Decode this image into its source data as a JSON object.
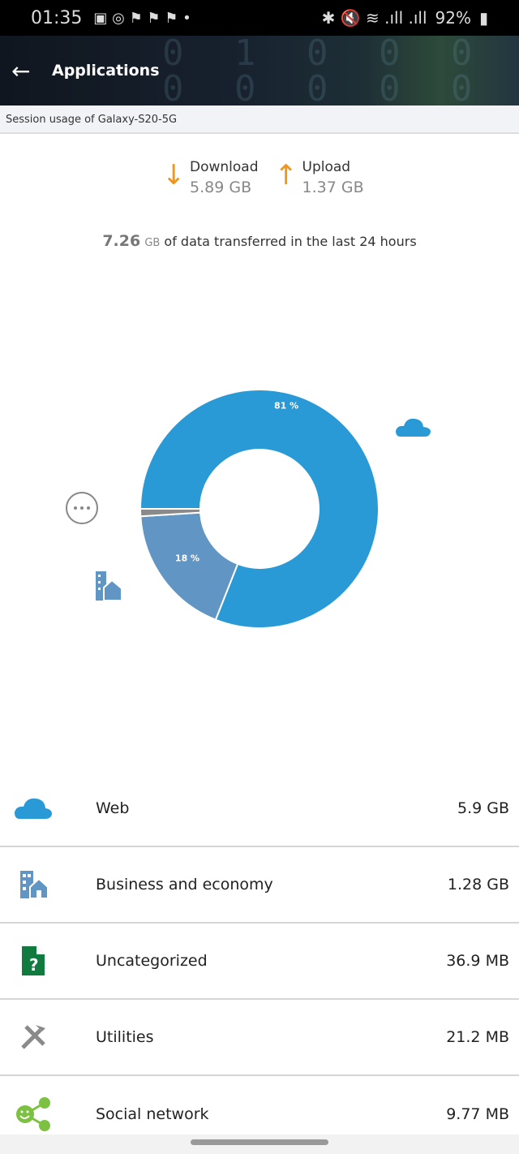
{
  "status_bar": {
    "time": "01:35",
    "battery": "92%"
  },
  "header": {
    "title": "Applications",
    "subtitle": "Session usage of Galaxy-S20-5G"
  },
  "transfer": {
    "download_label": "Download",
    "download_value": "5.89 GB",
    "upload_label": "Upload",
    "upload_value": "1.37 GB"
  },
  "summary": {
    "amount": "7.26",
    "unit": "GB",
    "text": "of data transferred in the last 24 hours"
  },
  "colors": {
    "web": "#2a9ad6",
    "business": "#6196c4",
    "other": "#8a8a8a",
    "accent": "#f0961e"
  },
  "chart_data": {
    "type": "pie",
    "donut": true,
    "start": "left",
    "direction": "clockwise",
    "categories": [
      "Web",
      "Business and economy",
      "Other"
    ],
    "values": [
      81,
      18,
      1
    ],
    "labels": [
      "81 %",
      "18 %",
      ""
    ],
    "icons": [
      "cloud-icon",
      "business-icon",
      "more-icon"
    ]
  },
  "categories": [
    {
      "name": "Web",
      "size": "5.9 GB",
      "icon": "cloud-icon"
    },
    {
      "name": "Business and economy",
      "size": "1.28 GB",
      "icon": "business-icon"
    },
    {
      "name": "Uncategorized",
      "size": "36.9 MB",
      "icon": "uncategorized-icon"
    },
    {
      "name": "Utilities",
      "size": "21.2 MB",
      "icon": "utilities-icon"
    },
    {
      "name": "Social network",
      "size": "9.77 MB",
      "icon": "social-network-icon"
    }
  ]
}
